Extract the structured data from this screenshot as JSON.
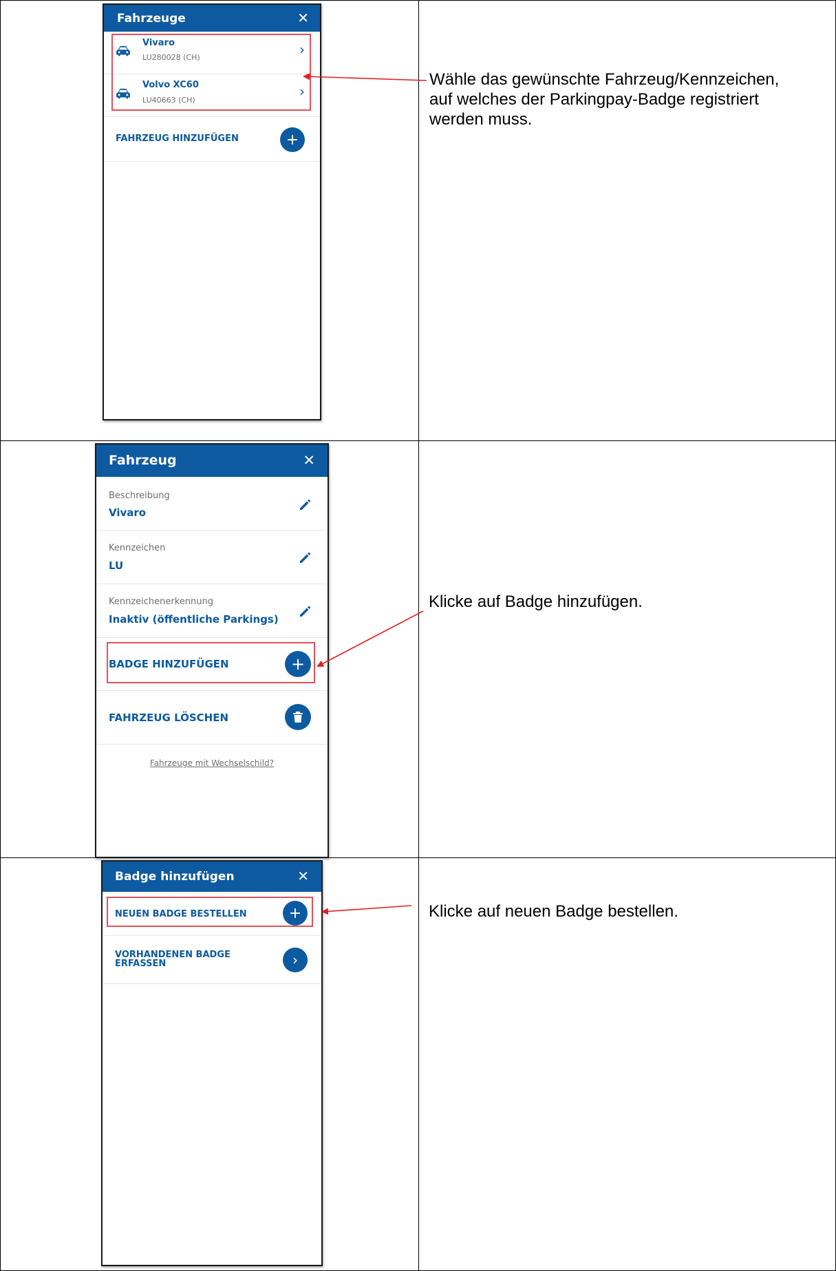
{
  "panels": {
    "vehicles": {
      "title": "Fahrzeuge",
      "close_icon": "close-icon",
      "items": [
        {
          "name": "Vivaro",
          "plate": "LU280028 (CH)",
          "icon": "car-icon"
        },
        {
          "name": "Volvo XC60",
          "plate": "LU40663 (CH)",
          "icon": "car-icon"
        }
      ],
      "add_label": "FAHRZEUG HINZUFÜGEN"
    },
    "vehicle": {
      "title": "Fahrzeug",
      "fields": [
        {
          "label": "Beschreibung",
          "value": "Vivaro"
        },
        {
          "label": "Kennzeichen",
          "value": "LU"
        },
        {
          "label": "Kennzeichenerkennung",
          "value": "Inaktiv (öffentliche Parkings)"
        }
      ],
      "add_badge_label": "BADGE HINZUFÜGEN",
      "delete_label": "FAHRZEUG LÖSCHEN",
      "link": "Fahrzeuge mit Wechselschild?"
    },
    "badge": {
      "title": "Badge hinzufügen",
      "order_label": "NEUEN BADGE BESTELLEN",
      "existing_label_line1": "VORHANDENEN BADGE",
      "existing_label_line2": "ERFASSEN"
    }
  },
  "instructions": {
    "step1_line1": "Wähle das gewünschte Fahrzeug/Kennzeichen,",
    "step1_line2": "auf welches der Parkingpay-Badge registriert",
    "step1_line3": "werden muss.",
    "step2": "Klicke auf Badge hinzufügen.",
    "step3": "Klicke auf neuen Badge bestellen."
  },
  "colors": {
    "brand_blue": "#0d5aa0",
    "highlight_red": "#e2505a",
    "arrow_red": "#e02020"
  }
}
